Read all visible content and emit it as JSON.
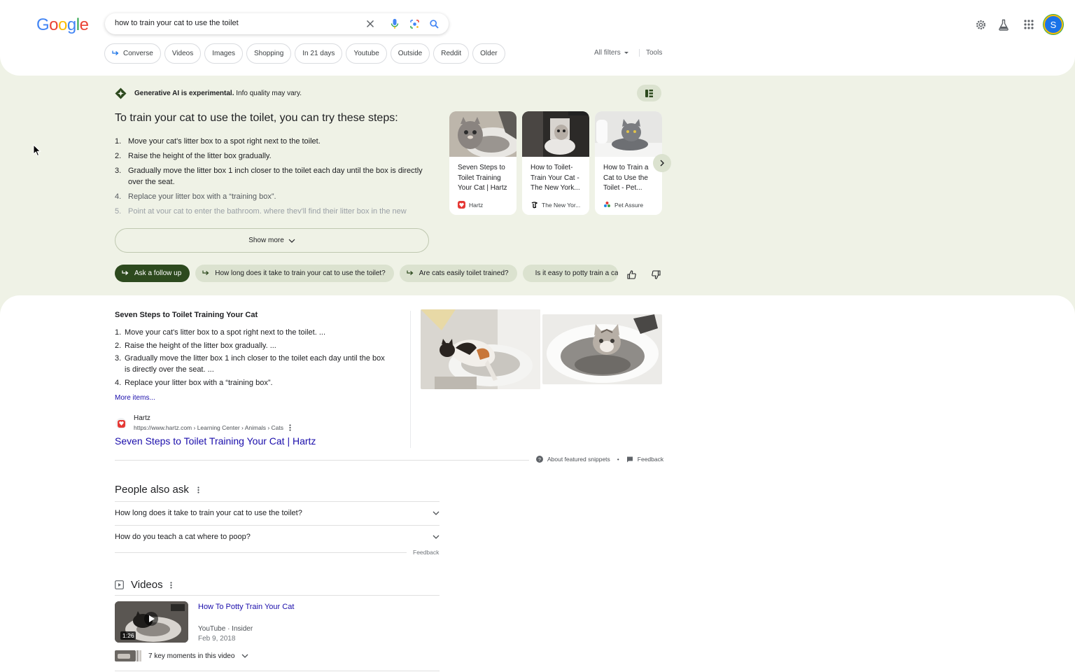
{
  "search": {
    "query": "how to train your cat to use the toilet"
  },
  "logo": {
    "letters": [
      "G",
      "o",
      "o",
      "g",
      "l",
      "e"
    ],
    "colors": [
      "#4285f4",
      "#ea4335",
      "#fbbc05",
      "#4285f4",
      "#34a853",
      "#ea4335"
    ]
  },
  "header": {
    "avatar_letter": "S"
  },
  "filters": {
    "chips": [
      "Converse",
      "Videos",
      "Images",
      "Shopping",
      "In 21 days",
      "Youtube",
      "Outside",
      "Reddit",
      "Older"
    ],
    "all_filters": "All filters",
    "tools": "Tools"
  },
  "ai_overview": {
    "notice_bold": "Generative AI is experimental.",
    "notice_rest": " Info quality may vary.",
    "title": "To train your cat to use the toilet, you can try these steps:",
    "steps": [
      {
        "num": "1.",
        "text": "Move your cat's litter box to a spot right next to the toilet."
      },
      {
        "num": "2.",
        "text": "Raise the height of the litter box gradually."
      },
      {
        "num": "3.",
        "text": "Gradually move the litter box 1 inch closer to the toilet each day until the box is directly over the seat."
      },
      {
        "num": "4.",
        "text": "Replace your litter box with a “training box”."
      },
      {
        "num": "5.",
        "text": "Point at your cat to enter the bathroom, where they'll find their litter box in the new"
      }
    ],
    "show_more": "Show more",
    "sources": [
      {
        "title": "Seven Steps to Toilet Training Your Cat | Hartz",
        "site": "Hartz"
      },
      {
        "title": "How to Toilet-Train Your Cat - The New York...",
        "site": "The New Yor..."
      },
      {
        "title": "How to Train a Cat to Use the Toilet - Pet...",
        "site": "Pet Assure"
      }
    ],
    "followups": {
      "ask": "Ask a follow up",
      "q1": "How long does it take to train your cat to use the toilet?",
      "q2": "Are cats easily toilet trained?",
      "q3": "Is it easy to potty train a cat?"
    }
  },
  "featured_snippet": {
    "title": "Seven Steps to Toilet Training Your Cat",
    "items": [
      {
        "num": "1.",
        "text": "Move your cat's litter box to a spot right next to the toilet. ..."
      },
      {
        "num": "2.",
        "text": "Raise the height of the litter box gradually. ..."
      },
      {
        "num": "3.",
        "text": "Gradually move the litter box 1 inch closer to the toilet each day until the box is directly over the seat. ..."
      },
      {
        "num": "4.",
        "text": "Replace your litter box with a “training box”."
      }
    ],
    "more_items": "More items...",
    "site_name": "Hartz",
    "site_url": "https://www.hartz.com › Learning Center › Animals › Cats",
    "link": "Seven Steps to Toilet Training Your Cat | Hartz",
    "about": "About featured snippets",
    "sep": "•",
    "feedback": "Feedback"
  },
  "people_also_ask": {
    "title": "People also ask",
    "questions": [
      "How long does it take to train your cat to use the toilet?",
      "How do you teach a cat where to poop?"
    ],
    "feedback": "Feedback"
  },
  "videos": {
    "title": "Videos",
    "item": {
      "title": "How To Potty Train Your Cat",
      "source": "YouTube · Insider",
      "date": "Feb 9, 2018",
      "duration": "1:26",
      "moments": "7 key moments in this video"
    }
  }
}
